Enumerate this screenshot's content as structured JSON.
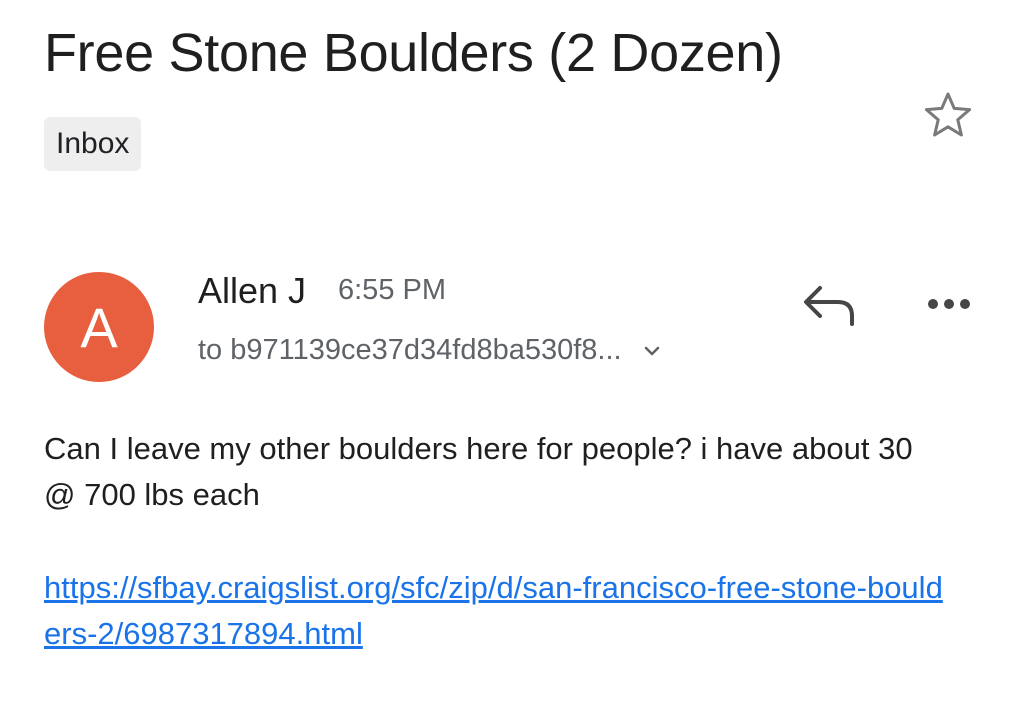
{
  "email": {
    "subject": "Free Stone Boulders (2 Dozen)",
    "label": "Inbox",
    "sender": {
      "name": "Allen J",
      "initial": "A",
      "avatar_color": "#e75f3e",
      "time": "6:55 PM",
      "recipient": "to b971139ce37d34fd8ba530f8..."
    },
    "body": "Can I leave my other boulders here for people? i have about 30 @ 700 lbs each",
    "link": "https://sfbay.craigslist.org/sfc/zip/d/san-francisco-free-stone-boulders-2/6987317894.html"
  },
  "icons": {
    "star": "star-outline-icon",
    "reply": "reply-arrow-icon",
    "more": "more-horizontal-icon",
    "expand": "chevron-down-icon"
  },
  "colors": {
    "link": "#1a73e8",
    "secondary_text": "#5f6368",
    "chip_background": "#eeeeee"
  }
}
